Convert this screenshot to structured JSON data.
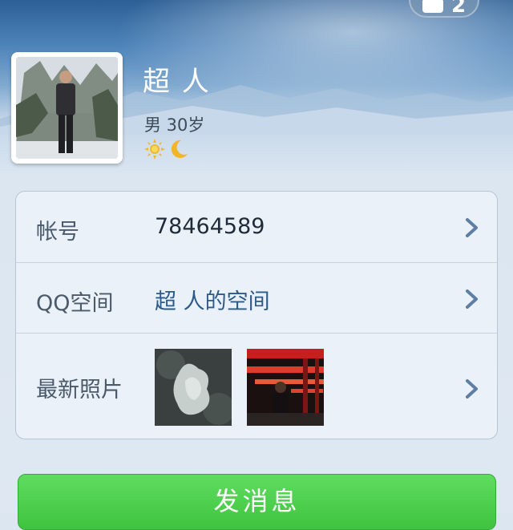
{
  "header": {
    "like_count": "2"
  },
  "profile": {
    "name": "超  人",
    "gender_age": "男  30岁",
    "status_icons": [
      "sun-icon",
      "moon-icon"
    ]
  },
  "info": {
    "account_label": "帐号",
    "account_value": "78464589",
    "qzone_label": "QQ空间",
    "qzone_value": "超  人的空间",
    "photos_label": "最新照片"
  },
  "actions": {
    "send_message": "发消息"
  },
  "colors": {
    "accent_green": "#46c948",
    "link_blue": "#2c5a8d"
  }
}
